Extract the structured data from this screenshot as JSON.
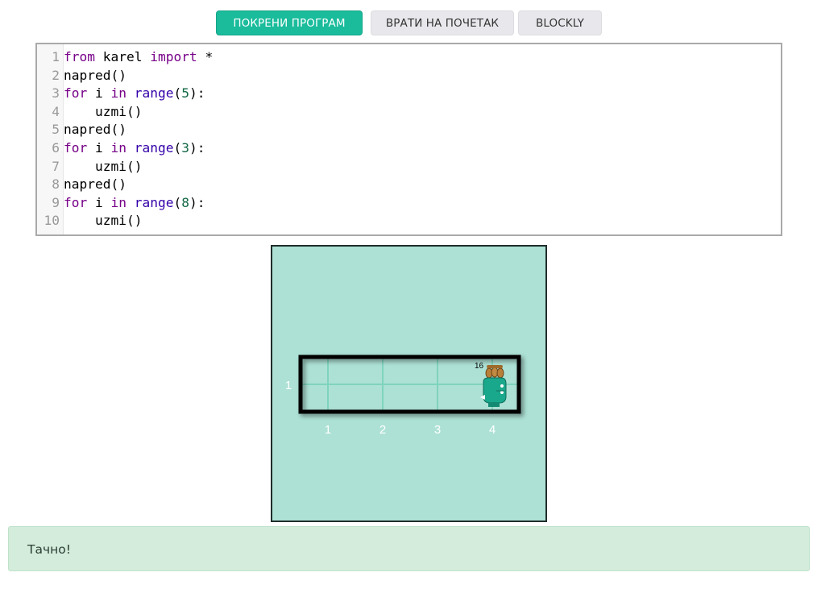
{
  "toolbar": {
    "run_label": "ПОКРЕНИ ПРОГРАМ",
    "reset_label": "ВРАТИ НА ПОЧЕТАК",
    "blockly_label": "BLOCKLY"
  },
  "editor": {
    "lines": [
      {
        "n": "1",
        "tokens": [
          {
            "t": "from",
            "c": "kw"
          },
          {
            "t": " karel ",
            "c": ""
          },
          {
            "t": "import",
            "c": "kw"
          },
          {
            "t": " *",
            "c": ""
          }
        ]
      },
      {
        "n": "2",
        "tokens": [
          {
            "t": "napred()",
            "c": ""
          }
        ]
      },
      {
        "n": "3",
        "tokens": [
          {
            "t": "for",
            "c": "kw"
          },
          {
            "t": " i ",
            "c": ""
          },
          {
            "t": "in",
            "c": "kw"
          },
          {
            "t": " ",
            "c": ""
          },
          {
            "t": "range",
            "c": "bi"
          },
          {
            "t": "(",
            "c": ""
          },
          {
            "t": "5",
            "c": "num"
          },
          {
            "t": "):",
            "c": ""
          }
        ]
      },
      {
        "n": "4",
        "tokens": [
          {
            "t": "    uzmi()",
            "c": ""
          }
        ]
      },
      {
        "n": "5",
        "tokens": [
          {
            "t": "napred()",
            "c": ""
          }
        ]
      },
      {
        "n": "6",
        "tokens": [
          {
            "t": "for",
            "c": "kw"
          },
          {
            "t": " i ",
            "c": ""
          },
          {
            "t": "in",
            "c": "kw"
          },
          {
            "t": " ",
            "c": ""
          },
          {
            "t": "range",
            "c": "bi"
          },
          {
            "t": "(",
            "c": ""
          },
          {
            "t": "3",
            "c": "num"
          },
          {
            "t": "):",
            "c": ""
          }
        ]
      },
      {
        "n": "7",
        "tokens": [
          {
            "t": "    uzmi()",
            "c": ""
          }
        ]
      },
      {
        "n": "8",
        "tokens": [
          {
            "t": "napred()",
            "c": ""
          }
        ]
      },
      {
        "n": "9",
        "tokens": [
          {
            "t": "for",
            "c": "kw"
          },
          {
            "t": " i ",
            "c": ""
          },
          {
            "t": "in",
            "c": "kw"
          },
          {
            "t": " ",
            "c": ""
          },
          {
            "t": "range",
            "c": "bi"
          },
          {
            "t": "(",
            "c": ""
          },
          {
            "t": "8",
            "c": "num"
          },
          {
            "t": "):",
            "c": ""
          }
        ]
      },
      {
        "n": "10",
        "tokens": [
          {
            "t": "    uzmi()",
            "c": ""
          }
        ]
      }
    ]
  },
  "world": {
    "row_labels": [
      "1"
    ],
    "col_labels": [
      "1",
      "2",
      "3",
      "4"
    ],
    "ball_count": "16",
    "robot_icon": "karel-robot-icon",
    "bag_icon": "ball-bag-icon",
    "colors": {
      "background": "#ade1d5",
      "grid": "#7fd3bf",
      "wall": "#000000",
      "label": "#ffffff"
    }
  },
  "result": {
    "message": "Тачно!"
  }
}
